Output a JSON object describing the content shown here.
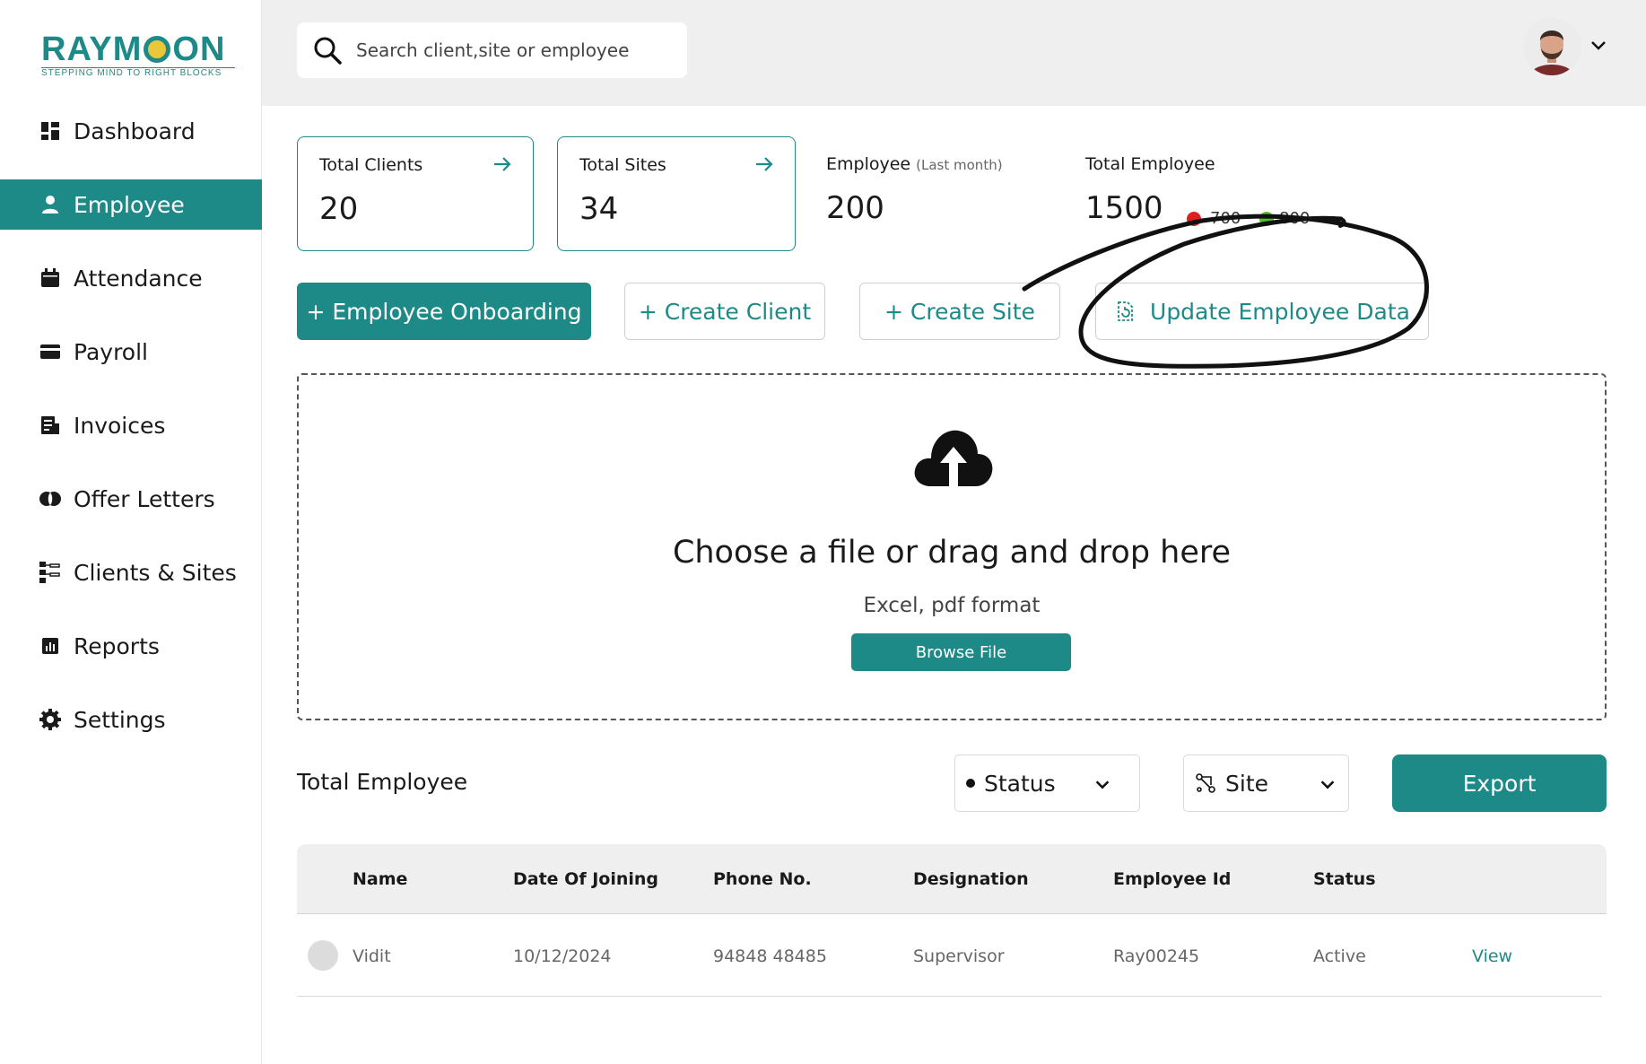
{
  "brand": {
    "logo_left": "RAYM",
    "logo_right": "ON",
    "tagline": "STEPPING MIND TO RIGHT BLOCKS"
  },
  "sidebar": {
    "items": [
      {
        "label": "Dashboard",
        "icon": "dashboard-icon"
      },
      {
        "label": "Employee",
        "icon": "user-icon",
        "active": true
      },
      {
        "label": "Attendance",
        "icon": "calendar-icon"
      },
      {
        "label": "Payroll",
        "icon": "card-icon"
      },
      {
        "label": "Invoices",
        "icon": "invoice-icon"
      },
      {
        "label": "Offer Letters",
        "icon": "offer-icon"
      },
      {
        "label": "Clients & Sites",
        "icon": "hierarchy-icon"
      },
      {
        "label": "Reports",
        "icon": "report-icon"
      },
      {
        "label": "Settings",
        "icon": "gear-icon"
      }
    ]
  },
  "header": {
    "search_placeholder": "Search client,site or employee"
  },
  "stats": {
    "total_clients": {
      "label": "Total Clients",
      "value": "20"
    },
    "total_sites": {
      "label": "Total Sites",
      "value": "34"
    },
    "employee_last_month": {
      "label": "Employee",
      "sub": "(Last month)",
      "value": "200"
    },
    "total_employee": {
      "label": "Total Employee",
      "value": "1500",
      "red_count": "700",
      "green_count": "800"
    }
  },
  "actions": {
    "onboarding": "+  Employee Onboarding",
    "create_client": "+ Create Client",
    "create_site": "+ Create Site",
    "update_data": "Update Employee Data"
  },
  "upload": {
    "title": "Choose a file or drag and drop here",
    "formats": "Excel, pdf format",
    "browse": "Browse File"
  },
  "list": {
    "title": "Total Employee",
    "status_filter": "Status",
    "site_filter": "Site",
    "export": "Export"
  },
  "table": {
    "columns": [
      "Name",
      "Date Of Joining",
      "Phone No.",
      "Designation",
      "Employee Id",
      "Status"
    ],
    "rows": [
      {
        "name": "Vidit",
        "doj": "10/12/2024",
        "phone": "94848 48485",
        "designation": "Supervisor",
        "emp_id": "Ray00245",
        "status": "Active",
        "action": "View"
      }
    ]
  },
  "colors": {
    "accent": "#1e8a88",
    "red_dot": "#e0201e",
    "green_dot": "#4fbf2a"
  }
}
